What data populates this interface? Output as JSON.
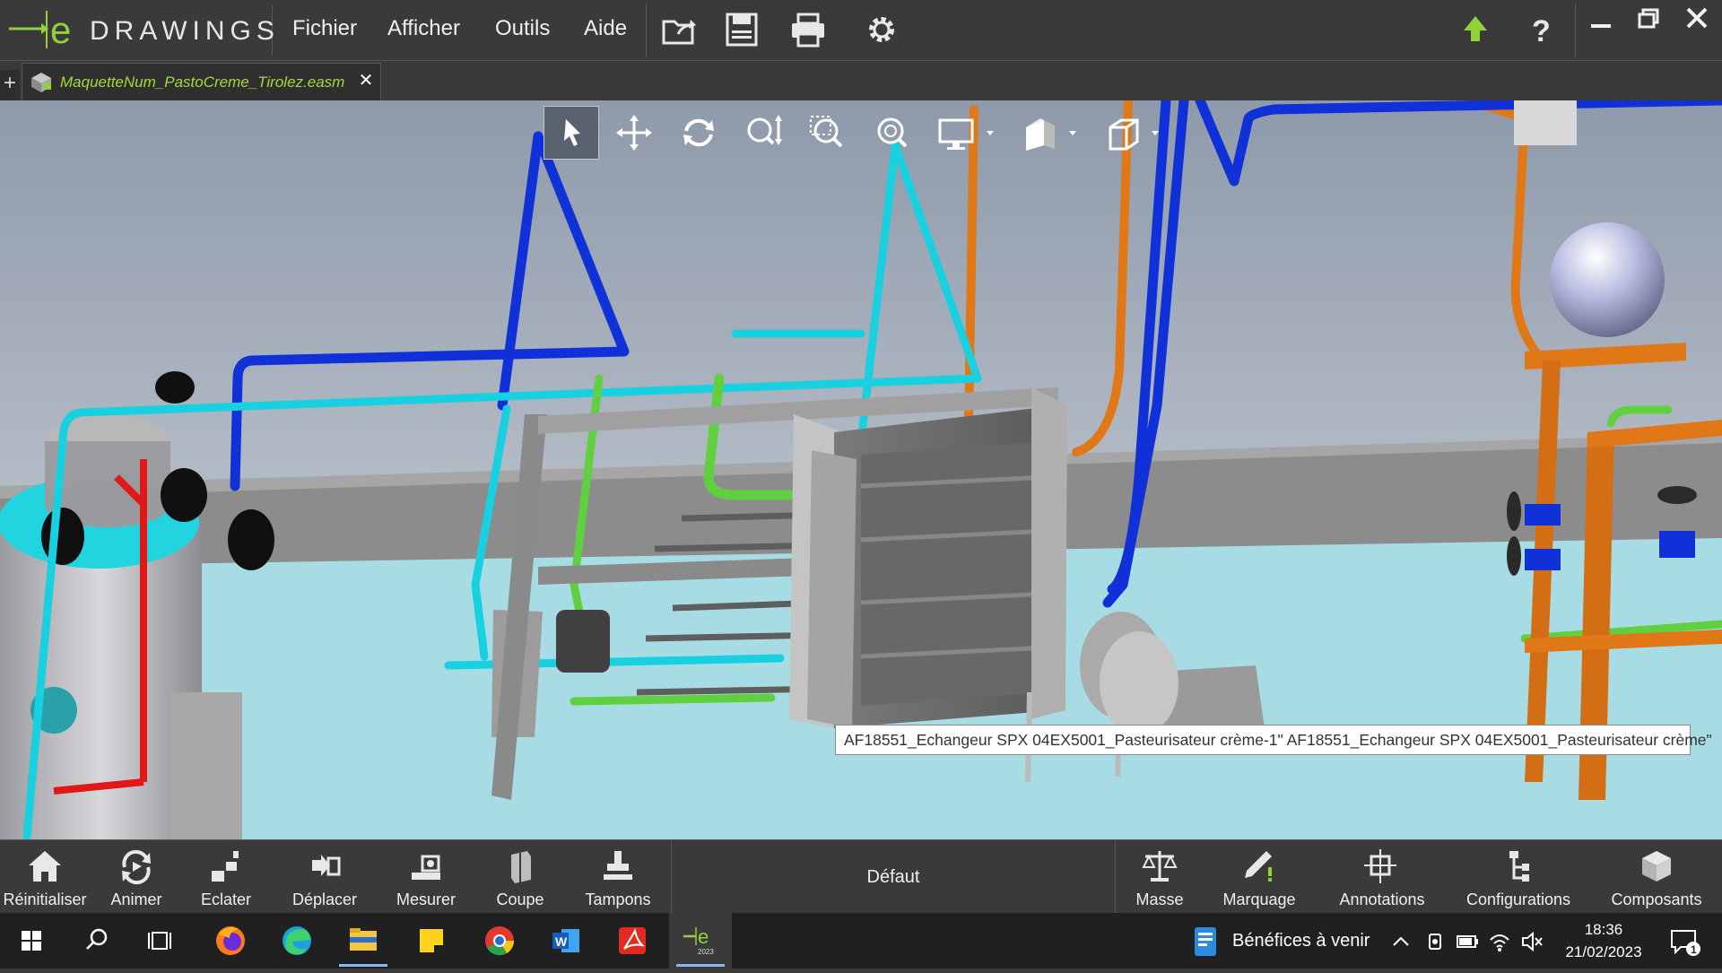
{
  "app": {
    "name": "DRAWINGS",
    "logo_letter": "e"
  },
  "menu": {
    "file": "Fichier",
    "view": "Afficher",
    "tools": "Outils",
    "help": "Aide"
  },
  "toolbar_icons": [
    "open-icon",
    "save-icon",
    "print-icon",
    "settings-icon"
  ],
  "title_right_icons": [
    "upload-arrow-icon",
    "help-icon"
  ],
  "window_controls": [
    "minimize-icon",
    "restore-icon",
    "close-icon"
  ],
  "tabs": [
    {
      "label": "MaquetteNum_PastoCreme_Tirolez.easm",
      "close": "✕"
    }
  ],
  "new_tab": "+",
  "view_tools": [
    "select",
    "pan",
    "rotate",
    "zoom",
    "zoom-to-area",
    "zoom-to-fit",
    "display-style",
    "shading",
    "view-orientation"
  ],
  "tooltip": "AF18551_Echangeur SPX 04EX5001_Pasteurisateur crème-1\" AF18551_Echangeur SPX 04EX5001_Pasteurisateur crème\"",
  "commands_left": [
    {
      "label": "Réinitialiser",
      "icon": "home-icon"
    },
    {
      "label": "Animer",
      "icon": "animate-icon"
    },
    {
      "label": "Eclater",
      "icon": "explode-icon"
    },
    {
      "label": "Déplacer",
      "icon": "move-component-icon"
    },
    {
      "label": "Mesurer",
      "icon": "measure-icon"
    },
    {
      "label": "Coupe",
      "icon": "section-icon"
    },
    {
      "label": "Tampons",
      "icon": "stamp-icon"
    }
  ],
  "configuration": "Défaut",
  "commands_right": [
    {
      "label": "Masse",
      "icon": "mass-scale-icon"
    },
    {
      "label": "Marquage",
      "icon": "markup-pencil-icon"
    },
    {
      "label": "Annotations",
      "icon": "annotations-icon"
    },
    {
      "label": "Configurations",
      "icon": "configurations-icon"
    },
    {
      "label": "Composants",
      "icon": "components-icon"
    }
  ],
  "taskbar": {
    "apps": [
      "windows-start",
      "search",
      "task-view",
      "firefox",
      "edge",
      "file-explorer",
      "sticky-notes",
      "chrome",
      "word",
      "acrobat",
      "edrawings-2023"
    ],
    "active_badge": "2023",
    "weather_text": "Bénéfices à venir",
    "time": "18:36",
    "date": "21/02/2023",
    "notification_count": "1"
  },
  "colors": {
    "chrome_bg": "#3a3a3a",
    "tab_label": "#9edc3e",
    "pipe_blue": "#1030d8",
    "pipe_cyan": "#18d0e0",
    "pipe_green": "#60d040",
    "pipe_orange": "#e07818",
    "pipe_red": "#e01818",
    "floor": "#a8dce4"
  }
}
